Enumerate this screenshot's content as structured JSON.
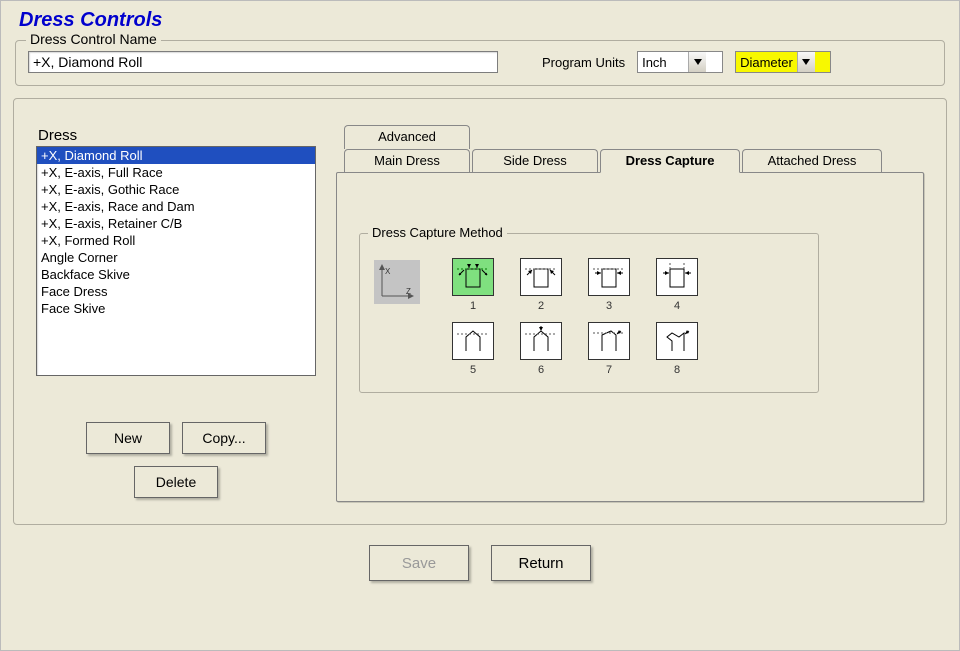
{
  "title": "Dress Controls",
  "name_group": {
    "legend": "Dress Control Name",
    "value": "+X, Diamond Roll",
    "units_label": "Program Units",
    "units_value": "Inch",
    "mode_value": "Diameter"
  },
  "dress_list": {
    "label": "Dress",
    "items": [
      "+X, Diamond Roll",
      "+X, E-axis, Full Race",
      "+X, E-axis, Gothic Race",
      "+X, E-axis, Race and Dam",
      "+X, E-axis, Retainer C/B",
      "+X, Formed Roll",
      "Angle Corner",
      "Backface Skive",
      "Face Dress",
      "Face Skive"
    ],
    "selected_index": 0
  },
  "buttons": {
    "new": "New",
    "copy": "Copy...",
    "delete": "Delete",
    "save": "Save",
    "return": "Return"
  },
  "tabs": {
    "advanced": "Advanced",
    "main": "Main Dress",
    "side": "Side Dress",
    "capture": "Dress Capture",
    "attached": "Attached Dress"
  },
  "method": {
    "legend": "Dress Capture Method",
    "axis_x": "X",
    "axis_z": "Z",
    "numbers": [
      "1",
      "2",
      "3",
      "4",
      "5",
      "6",
      "7",
      "8"
    ],
    "selected": 0
  }
}
